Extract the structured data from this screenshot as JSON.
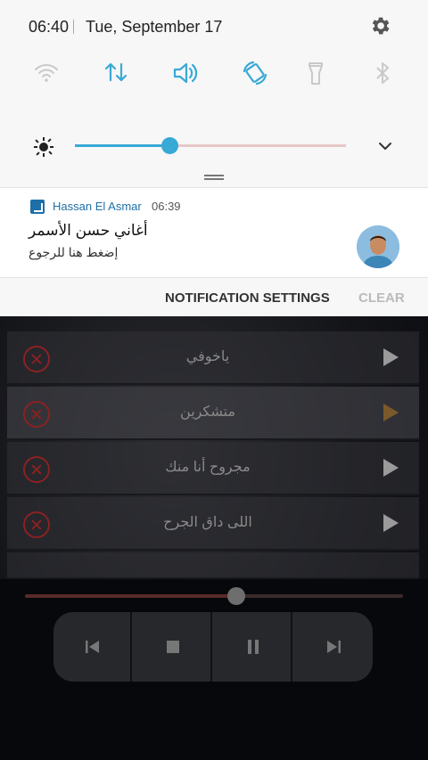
{
  "statusbar": {
    "time": "06:40",
    "date": "Tue, September 17"
  },
  "quick_settings": [
    {
      "name": "wifi",
      "state": "off"
    },
    {
      "name": "mobile-data",
      "state": "on"
    },
    {
      "name": "sound",
      "state": "on"
    },
    {
      "name": "auto-rotate",
      "state": "on"
    },
    {
      "name": "flashlight",
      "state": "off"
    },
    {
      "name": "bluetooth",
      "state": "off"
    }
  ],
  "brightness": {
    "level": 0.35
  },
  "notification": {
    "app_name": "Hassan El Asmar",
    "time": "06:39",
    "title": "أغاني حسن الأسمر",
    "text": "إضغط هنا للرجوع"
  },
  "actions": {
    "settings_label": "NOTIFICATION SETTINGS",
    "clear_label": "CLEAR"
  },
  "playlist": [
    {
      "title": "ياخوفي",
      "active": false
    },
    {
      "title": "متشكرين",
      "active": true
    },
    {
      "title": "مجروح أنا منك",
      "active": false
    },
    {
      "title": "اللى داق الجرح",
      "active": false
    }
  ],
  "player": {
    "progress": 0.56
  },
  "colors": {
    "accent": "#39a9d6",
    "delete": "#8b2121",
    "brand": "#1f6fa6"
  }
}
